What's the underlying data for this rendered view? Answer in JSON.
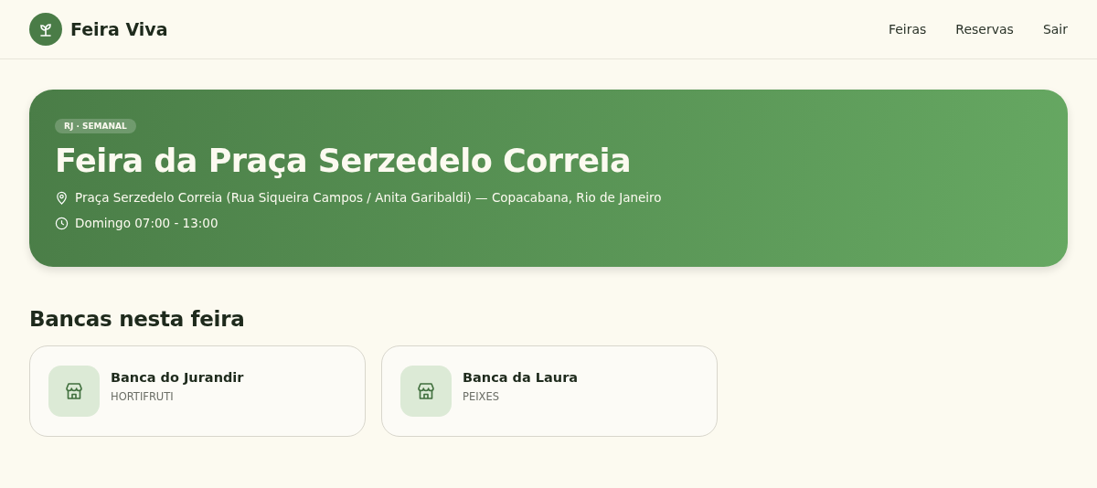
{
  "header": {
    "brand": "Feira Viva",
    "nav": [
      "Feiras",
      "Reservas",
      "Sair"
    ]
  },
  "hero": {
    "badge": "RJ · SEMANAL",
    "title": "Feira da Praça Serzedelo Correia",
    "address": "Praça Serzedelo Correia (Rua Siqueira Campos / Anita Garibaldi) — Copacabana, Rio de Janeiro",
    "schedule": "Domingo 07:00 - 13:00"
  },
  "section": {
    "title": "Bancas nesta feira",
    "stalls": [
      {
        "name": "Banca do Jurandir",
        "category": "HORTIFRUTI"
      },
      {
        "name": "Banca da Laura",
        "category": "PEIXES"
      }
    ]
  }
}
